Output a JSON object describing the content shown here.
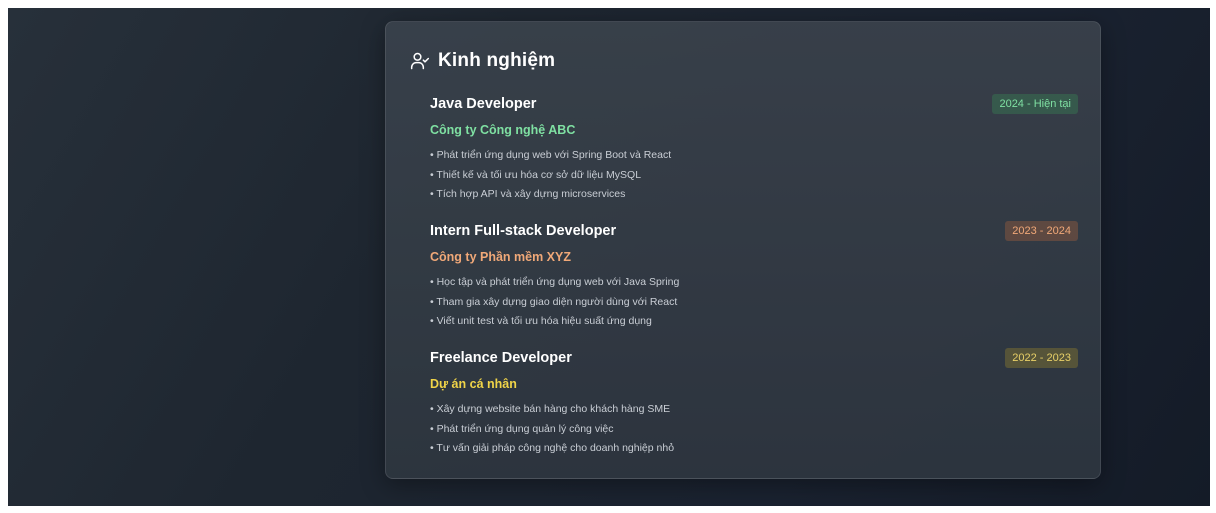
{
  "section": {
    "title": "Kinh nghiệm",
    "icon": "user-check-icon"
  },
  "jobs": [
    {
      "title": "Java Developer",
      "period": "2024 - Hiện tại",
      "company": "Công ty Công nghệ ABC",
      "accent": "#7fe0a2",
      "bullets": [
        "• Phát triển ứng dụng web với Spring Boot và React",
        "• Thiết kế và tối ưu hóa cơ sở dữ liệu MySQL",
        "• Tích hợp API và xây dựng microservices"
      ]
    },
    {
      "title": "Intern Full-stack Developer",
      "period": "2023 - 2024",
      "company": "Công ty Phần mềm XYZ",
      "accent": "#f0a878",
      "bullets": [
        "• Học tập và phát triển ứng dụng web với Java Spring",
        "• Tham gia xây dựng giao diện người dùng với React",
        "• Viết unit test và tối ưu hóa hiệu suất ứng dụng"
      ]
    },
    {
      "title": "Freelance Developer",
      "period": "2022 - 2023",
      "company": "Dự án cá nhân",
      "accent": "#f0d448",
      "bullets": [
        "• Xây dựng website bán hàng cho khách hàng SME",
        "• Phát triển ứng dụng quản lý công việc",
        "• Tư vấn giải pháp công nghệ cho doanh nghiệp nhỏ"
      ]
    }
  ]
}
